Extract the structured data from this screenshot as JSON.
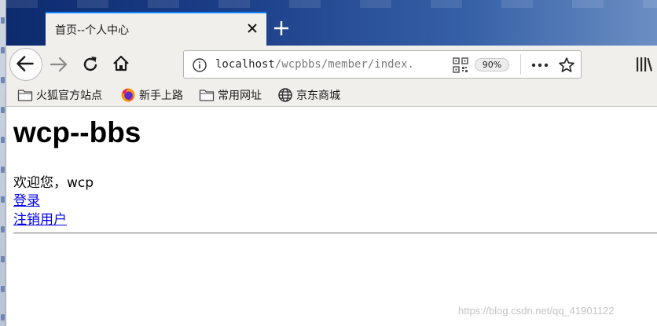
{
  "browser": {
    "tab": {
      "title": "首页--个人中心"
    },
    "address_bar": {
      "url_host": "localhost",
      "url_path": "/wcpbbs/member/index.",
      "zoom": "90%"
    },
    "bookmarks": [
      {
        "label": "火狐官方站点",
        "icon": "folder-icon"
      },
      {
        "label": "新手上路",
        "icon": "firefox-icon"
      },
      {
        "label": "常用网址",
        "icon": "folder-icon"
      },
      {
        "label": "京东商城",
        "icon": "globe-icon"
      }
    ]
  },
  "page": {
    "heading": "wcp--bbs",
    "welcome": "欢迎您，wcp",
    "links": {
      "login": "登录",
      "register": "注销用户"
    }
  },
  "watermark": "https://blog.csdn.net/qq_41901122",
  "colors": {
    "tab_accent": "#0a84ff",
    "link": "#0000ee",
    "title_bar": "#1c3f88"
  }
}
